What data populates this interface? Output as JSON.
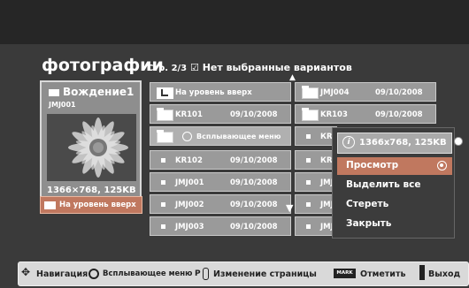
{
  "header": {
    "title": "фотографии"
  },
  "page_info": {
    "page": "Стр. 2/3",
    "checkbox_symbol": "☑",
    "selection_text": "Нет выбранные вариантов"
  },
  "preview": {
    "folder_name": "Вождение1",
    "file_name": "JMJ001",
    "size": "1366×768, 125KB"
  },
  "side_button": {
    "label": "На уровень вверх"
  },
  "grid": {
    "up_level": "На уровень вверх",
    "popup_menu_label": "Всплывающее меню",
    "rows": [
      {
        "name": "KR101",
        "date": "09/10/2008"
      },
      {
        "name": "KR102",
        "date": "09/10/2008"
      },
      {
        "name": "JMJ001",
        "date": "09/10/2008"
      },
      {
        "name": "JMJ002",
        "date": "09/10/2008"
      },
      {
        "name": "JMJ003",
        "date": "09/10/2008"
      }
    ],
    "right_col": [
      {
        "name": "JMJ004",
        "date": "09/10/2008"
      },
      {
        "name": "KR103",
        "date": "09/10/2008"
      },
      {
        "name": "КR"
      },
      {
        "name": "КR"
      },
      {
        "name": "JMJ"
      },
      {
        "name": "JMJ"
      },
      {
        "name": "JMJ"
      }
    ]
  },
  "popup": {
    "info": "1366x768, 125KB",
    "items": [
      "Просмотр",
      "Выделить все",
      "Стереть",
      "Закрыть"
    ]
  },
  "bottom_bar": {
    "navigation": "Навигация",
    "popup_menu": "Всплывающее меню",
    "page_key": "P",
    "page_change": "Изменение страницы",
    "mark_key": "MARK",
    "mark": "Отметить",
    "exit": "Выход"
  },
  "colors": {
    "accent": "#c0785f",
    "cell": "#9a9a9a",
    "background": "#3a3a3a"
  }
}
